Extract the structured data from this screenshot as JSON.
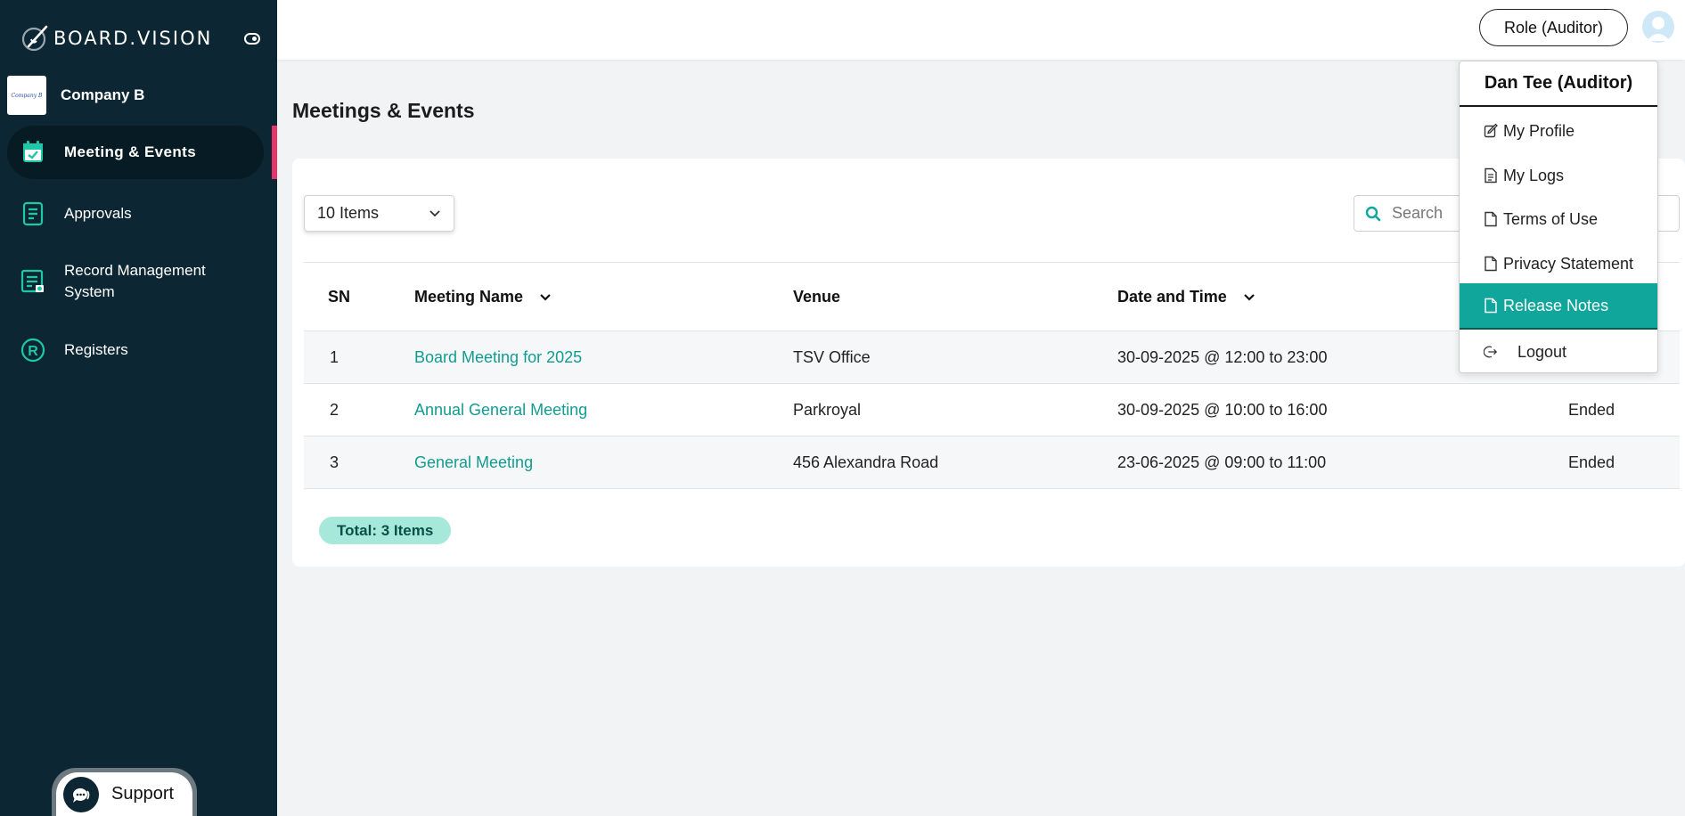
{
  "app": {
    "brand": "BOARD.VISION"
  },
  "company": {
    "name": "Company B",
    "logo_text": "Company B"
  },
  "sidebar": {
    "items": [
      {
        "label": "Meeting & Events",
        "icon": "calendar-check-icon",
        "active": true
      },
      {
        "label": "Approvals",
        "icon": "document-list-icon",
        "active": false
      },
      {
        "label": "Record Management System",
        "icon": "records-icon",
        "active": false
      },
      {
        "label": "Registers",
        "icon": "registered-icon",
        "active": false
      }
    ],
    "support_label": "Support"
  },
  "header": {
    "role_button": "Role (Auditor)"
  },
  "page": {
    "title": "Meetings & Events"
  },
  "controls": {
    "page_size": "10 Items",
    "search_placeholder": "Search"
  },
  "table": {
    "columns": [
      "SN",
      "Meeting Name",
      "Venue",
      "Date and Time"
    ],
    "rows": [
      {
        "sn": "1",
        "name": "Board Meeting for 2025",
        "venue": "TSV Office",
        "datetime": "30-09-2025 @ 12:00 to 23:00",
        "status": ""
      },
      {
        "sn": "2",
        "name": "Annual General Meeting",
        "venue": "Parkroyal",
        "datetime": "30-09-2025 @ 10:00 to 16:00",
        "status": "Ended"
      },
      {
        "sn": "3",
        "name": "General Meeting",
        "venue": "456 Alexandra Road",
        "datetime": "23-06-2025 @ 09:00 to 11:00",
        "status": "Ended"
      }
    ],
    "total": "Total: 3 Items"
  },
  "user_menu": {
    "user_name": "Dan Tee (Auditor)",
    "items": [
      {
        "label": "My Profile",
        "icon": "edit-icon"
      },
      {
        "label": "My Logs",
        "icon": "log-file-icon"
      },
      {
        "label": "Terms of Use",
        "icon": "file-icon"
      },
      {
        "label": "Privacy Statement",
        "icon": "file-icon"
      },
      {
        "label": "Release Notes",
        "icon": "file-icon",
        "active": true
      },
      {
        "label": "Logout",
        "icon": "logout-icon"
      }
    ]
  },
  "colors": {
    "sidebar": "#0c2733",
    "accent": "#11a69c",
    "link": "#129c91",
    "active_marker": "#e8336b",
    "badge": "#a6e8da"
  }
}
